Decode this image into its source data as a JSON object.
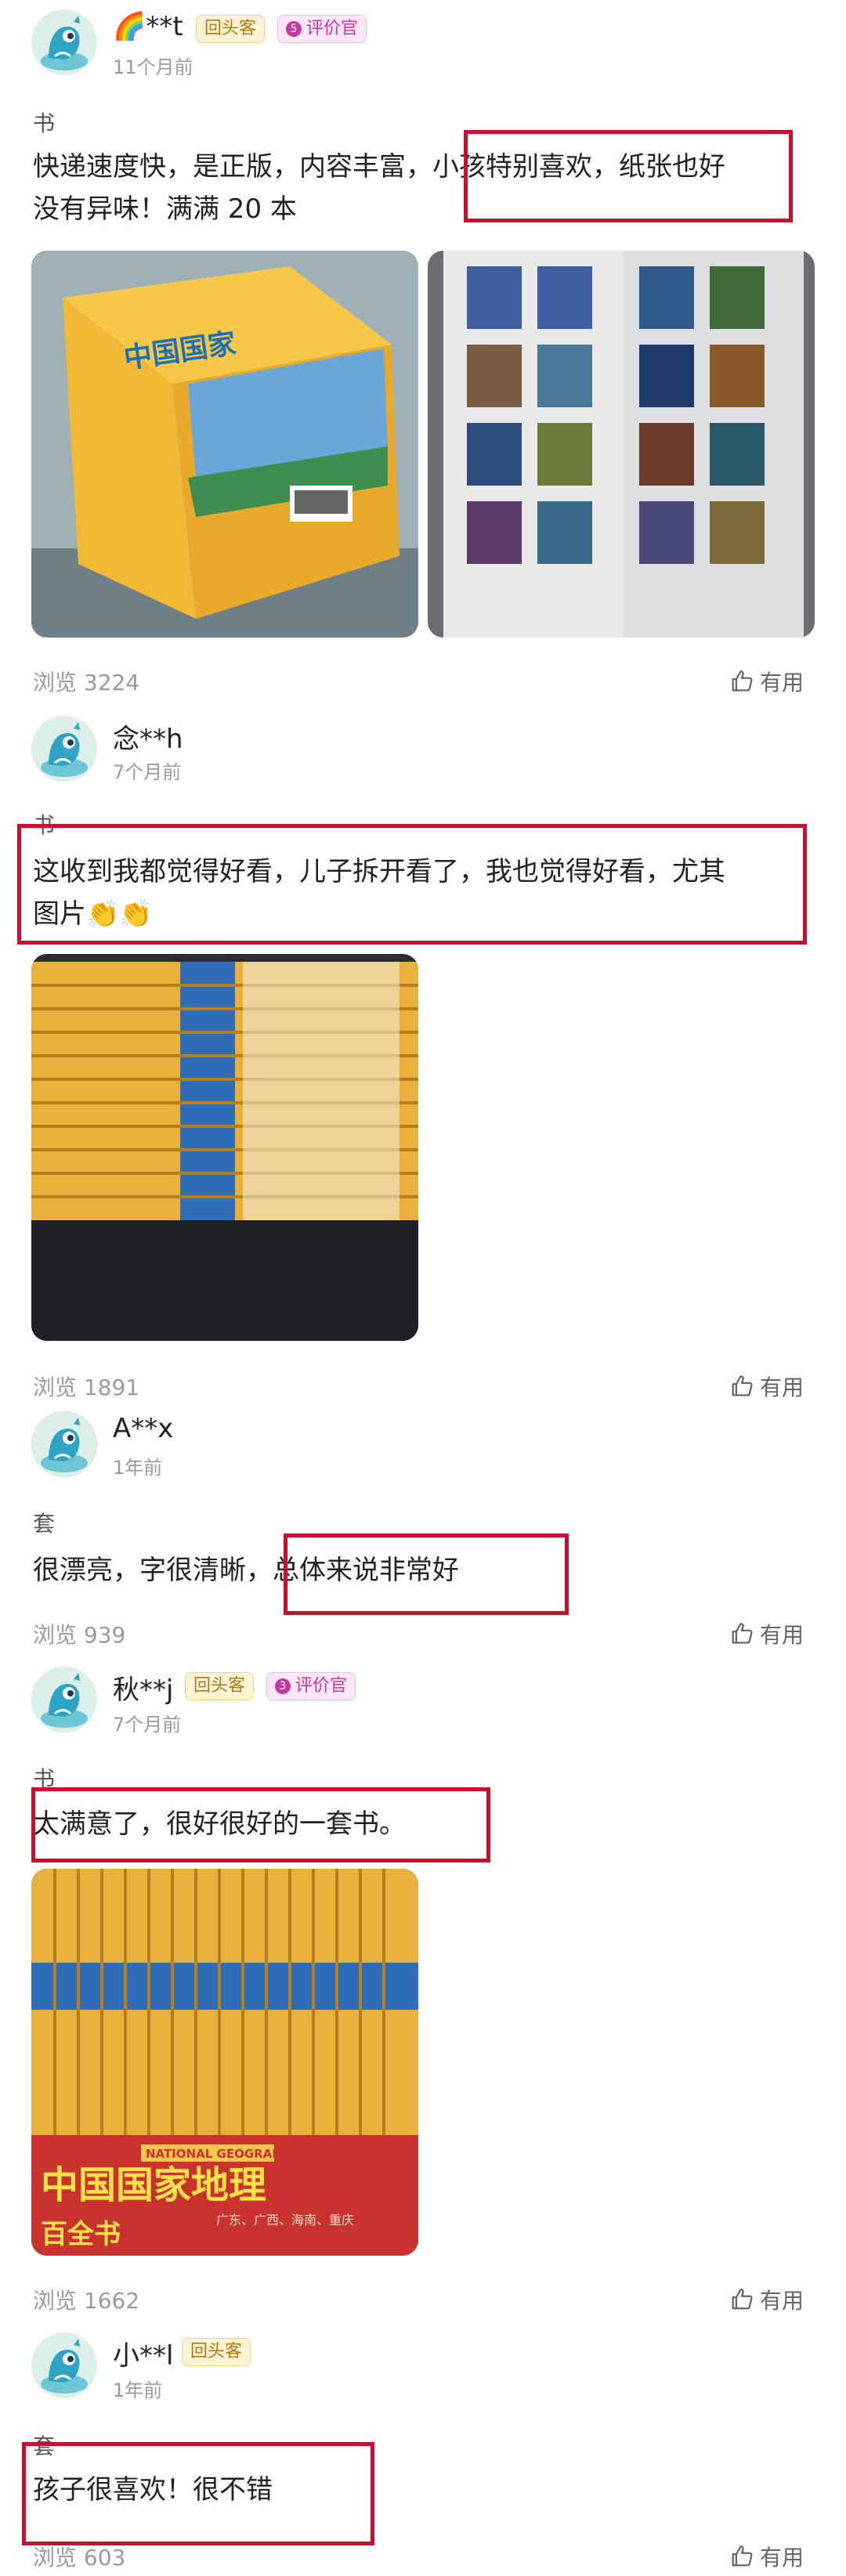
{
  "reviews": [
    {
      "user": "**t",
      "user_prefix_emoji": "🌈",
      "time": "11个月前",
      "badges": [
        "回头客",
        "评价官"
      ],
      "critic_level": "5",
      "category": "书",
      "text_line1_before": "快递速度快，是正版，内容丰富，",
      "text_line1_highlight": "小孩特别喜欢，纸张也好",
      "text_line2": "没有异味！满满 20 本",
      "views": "浏览 3224",
      "useful": "有用"
    },
    {
      "user": "念**h",
      "time": "7个月前",
      "category": "书",
      "text_line1": "这收到我都觉得好看，儿子拆开看了，我也觉得好看，尤其",
      "text_line2": "图片👏👏",
      "views": "浏览 1891",
      "useful": "有用"
    },
    {
      "user": "A**x",
      "time": "1年前",
      "category": "套",
      "text_before": "很漂亮，字很清晰，",
      "text_highlight": "总体来说非常好",
      "views": "浏览 939",
      "useful": "有用"
    },
    {
      "user": "秋**j",
      "time": "7个月前",
      "badges": [
        "回头客",
        "评价官"
      ],
      "critic_level": "3",
      "category": "书",
      "text": "太满意了，很好很好的一套书。",
      "photo_text_brand": "NATIONAL GEOGRAPHIC",
      "photo_text_title": "中国国家地理",
      "photo_text_sub": "百全书",
      "photo_text_regions": "广东、广西、海南、重庆",
      "views": "浏览 1662",
      "useful": "有用"
    },
    {
      "user": "小**l",
      "time": "1年前",
      "badges": [
        "回头客"
      ],
      "category": "套",
      "text": "孩子很喜欢！很不错",
      "views": "浏览 603",
      "useful": "有用"
    }
  ],
  "colors": {
    "highlight": "#c8102e",
    "muted": "#9a9a9a",
    "return_badge": "#b07a12",
    "critic_badge": "#c23aa0"
  },
  "icons": [
    "avatar-mascot-icon",
    "thumbs-up-icon"
  ]
}
